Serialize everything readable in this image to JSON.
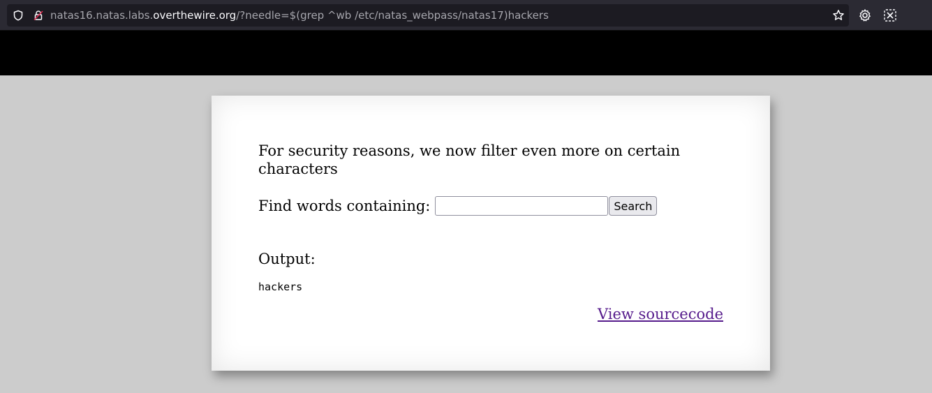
{
  "browser": {
    "url_prefix": "natas16.natas.labs.",
    "url_host": "overthewire.org",
    "url_suffix": "/?needle=$(grep ^wb /etc/natas_webpass/natas17)hackers",
    "icons": [
      "shield-icon",
      "lock-icon",
      "star-icon",
      "gear-icon",
      "extension-icon"
    ]
  },
  "page": {
    "intro": "For security reasons, we now filter even more on certain characters",
    "find_label": "Find words containing:",
    "needle_value": "",
    "search_button": "Search",
    "output_heading": "Output:",
    "output_text": "hackers",
    "source_link": "View sourcecode"
  },
  "colors": {
    "toolbar": "#2b2a33",
    "urlbar": "#1c1b22",
    "page_background": "#cccccc",
    "card": "#ffffff",
    "link_visited": "#551a8b"
  }
}
